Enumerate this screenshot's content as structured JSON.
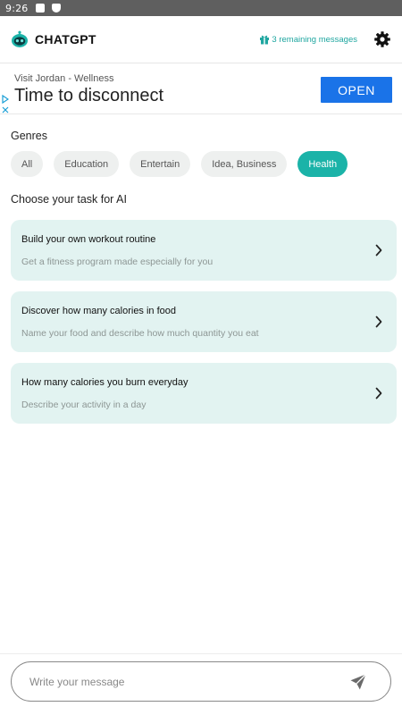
{
  "status_bar": {
    "time": "9:26",
    "icons": [
      "android-icon",
      "shield-icon"
    ]
  },
  "header": {
    "app_title": "CHATGPT",
    "remaining_text": "3 remaining messages",
    "logo_icon": "robot-icon",
    "settings_icon": "gear-icon",
    "accent_color": "#1bb3a8"
  },
  "ad": {
    "subtitle": "Visit Jordan - Wellness",
    "title": "Time to disconnect",
    "cta": "OPEN",
    "cta_color": "#1a73e8"
  },
  "genres": {
    "label": "Genres",
    "items": [
      {
        "label": "All",
        "active": false
      },
      {
        "label": "Education",
        "active": false
      },
      {
        "label": "Entertain",
        "active": false
      },
      {
        "label": "Idea, Business",
        "active": false
      },
      {
        "label": "Health",
        "active": true
      }
    ]
  },
  "tasks": {
    "label": "Choose your task for AI",
    "items": [
      {
        "title": "Build your own workout routine",
        "description": "Get a fitness program made especially for you"
      },
      {
        "title": "Discover how many calories in food",
        "description": "Name your food and describe how much quantity you eat"
      },
      {
        "title": "How many calories you burn everyday",
        "description": "Describe your activity in a day"
      }
    ]
  },
  "composer": {
    "placeholder": "Write your message",
    "send_icon": "send-icon"
  }
}
